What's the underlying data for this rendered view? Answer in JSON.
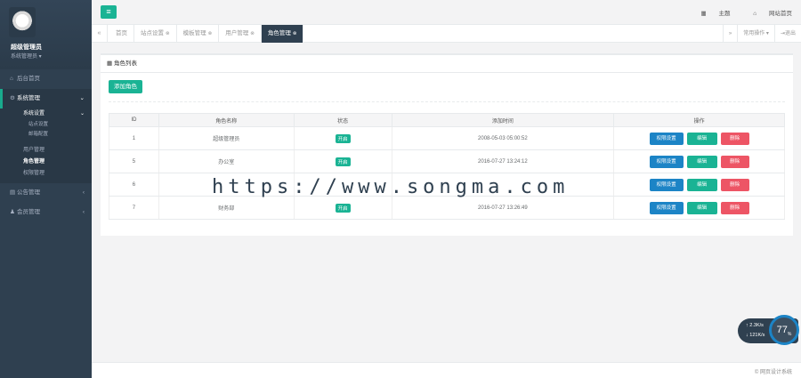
{
  "sidebar": {
    "profile_name": "超级管理员",
    "profile_role": "系统管理员",
    "items": [
      {
        "label": "后台首页"
      },
      {
        "label": "系统管理"
      },
      {
        "label": "公告管理"
      },
      {
        "label": "会员管理"
      }
    ],
    "sub_basic": "系统设置",
    "sub_basic_children": [
      "站点设置",
      "邮箱配置"
    ],
    "sub_other": [
      "用户管理",
      "角色管理",
      "权限管理"
    ]
  },
  "header": {
    "menu_icon": "≡",
    "theme": "主题",
    "site_home": "网站首页"
  },
  "tabs": [
    {
      "label": "首页"
    },
    {
      "label": "站点设置"
    },
    {
      "label": "模板管理"
    },
    {
      "label": "用户管理"
    },
    {
      "label": "角色管理"
    }
  ],
  "tabs_right": {
    "action": "常用操作",
    "logout": "退出"
  },
  "panel": {
    "title": "角色列表",
    "add_button": "添加角色"
  },
  "table": {
    "headers": [
      "ID",
      "角色名称",
      "状态",
      "添加时间",
      "操作"
    ],
    "rows": [
      {
        "id": "1",
        "name": "超级管理员",
        "status": "开启",
        "time": "2008-05-03 05:00:52"
      },
      {
        "id": "5",
        "name": "办公室",
        "status": "开启",
        "time": "2016-07-27 13:24:12"
      },
      {
        "id": "6",
        "name": "",
        "status": "",
        "time": ""
      },
      {
        "id": "7",
        "name": "财务部",
        "status": "开启",
        "time": "2016-07-27 13:26:49"
      }
    ],
    "actions": {
      "perm": "权限设置",
      "edit": "编辑",
      "delete": "删除"
    }
  },
  "watermark": "https://www.songma.com",
  "speed": {
    "up": "2.3",
    "down": "121",
    "unit": "K/s",
    "percent": "77",
    "percent_unit": "%"
  },
  "footer": {
    "text": "© 网页设计系统"
  }
}
